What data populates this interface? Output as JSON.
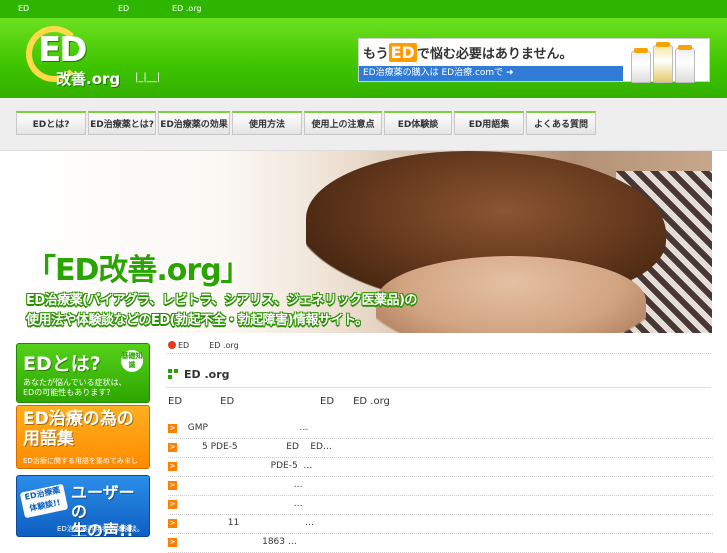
{
  "topbar": {
    "left": "ED",
    "middle": "ED",
    "right": "ED .org"
  },
  "header": {
    "logo_ed": "ED",
    "logo_domain": "改善.org",
    "logo_sub": "|_|__|",
    "banner": {
      "text_before": "もう",
      "text_ed": "ED",
      "text_after": "で悩む必要はありません。",
      "bottom": "ED治療薬の購入は ED治療.comで ➜"
    }
  },
  "nav": {
    "items": [
      "EDとは?",
      "ED治療薬とは?",
      "ED治療薬の効果",
      "使用方法",
      "使用上の注意点",
      "ED体験談",
      "ED用語集",
      "よくある質問"
    ]
  },
  "hero": {
    "title": "「ED改善.org」",
    "line1": "ED治療薬(バイアグラ、レビトラ、シアリス、ジェネリック医薬品)の",
    "line2": "使用法や体験談などのED(勃起不全・勃起障害)情報サイト。"
  },
  "sidebar": {
    "btn1": {
      "big": "EDとは?",
      "badge": "基礎知識",
      "small1": "あなたが悩んでいる症状は、",
      "small2": "EDの可能性もあります?"
    },
    "btn2": {
      "big1": "ED治療の為の",
      "big2": "用語集",
      "small": "ED治療に関する用語を集めてみました。"
    },
    "btn3": {
      "tag": "ED治療薬体験談!!",
      "big1": "ユーザーの",
      "big2": "生の声!!",
      "small": "ED治療薬利用者の体験談。"
    }
  },
  "main": {
    "breadcrumb": {
      "home": "ED",
      "current": "ED .org"
    },
    "section_title": "ED .org",
    "intro": "ED            ED                           ED      ED .org",
    "list": [
      "  GMP                                …",
      "       5 PDE-5                 ED    ED…",
      "                               PDE-5  …",
      "                                       …",
      "                                       …",
      "                11                       …",
      "                            1863 …"
    ]
  }
}
